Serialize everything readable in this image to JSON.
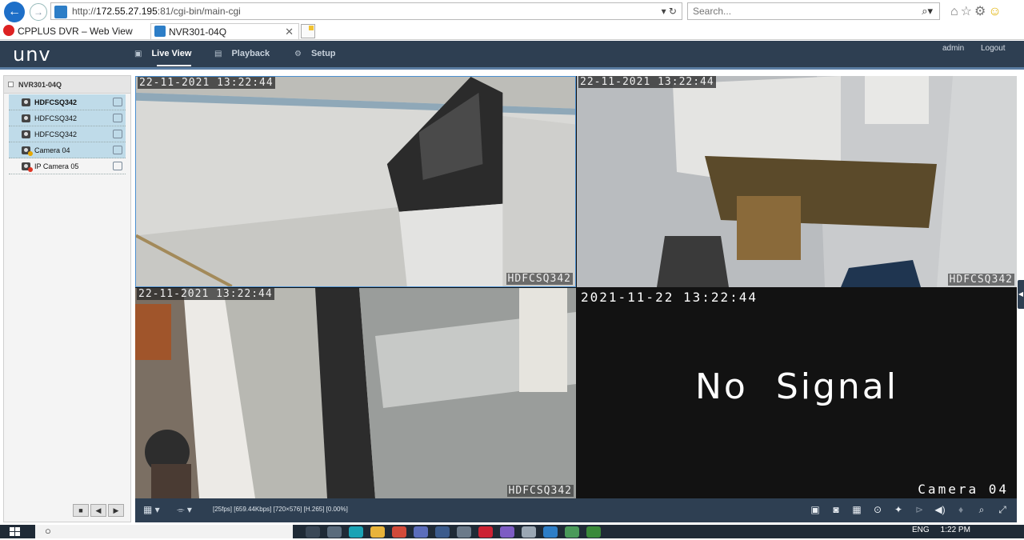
{
  "browser": {
    "address_prefix": "http://",
    "address_host": "172.55.27.195",
    "address_rest": ":81/cgi-bin/main-cgi",
    "address_controls": "▾ ↻",
    "search_placeholder": "Search...",
    "tabs": [
      {
        "label": "CPPLUS DVR – Web View"
      },
      {
        "label": "NVR301-04Q"
      }
    ]
  },
  "app": {
    "logo": "unv",
    "nav": [
      {
        "label": "Live View",
        "icon": "monitor-icon"
      },
      {
        "label": "Playback",
        "icon": "film-icon"
      },
      {
        "label": "Setup",
        "icon": "gear-icon"
      }
    ],
    "user": "admin",
    "logout": "Logout"
  },
  "sidebar": {
    "root": "NVR301-04Q",
    "cameras": [
      {
        "name": "HDFCSQ342",
        "status": "online"
      },
      {
        "name": "HDFCSQ342",
        "status": "online"
      },
      {
        "name": "HDFCSQ342",
        "status": "online"
      },
      {
        "name": "Camera 04",
        "status": "warning"
      },
      {
        "name": "IP Camera 05",
        "status": "offline"
      }
    ],
    "controls": [
      "■",
      "◀",
      "▶"
    ]
  },
  "tiles": [
    {
      "timestamp": "22-11-2021 13:22:44",
      "name": "HDFCSQ342"
    },
    {
      "timestamp": "22-11-2021 13:22:44",
      "name": "HDFCSQ342"
    },
    {
      "timestamp": "22-11-2021 13:22:44",
      "name": "HDFCSQ342"
    },
    {
      "timestamp": "2021-11-22 13:22:44",
      "name": "Camera 04",
      "message": "No Signal"
    }
  ],
  "toolbar": {
    "layout_label": "▦ ▾",
    "stream_label": "⌯ ▾",
    "stream_info": "[25fps] [659.44Kbps] [720×576] [H.265] [0.00%]"
  },
  "taskbar": {
    "language": "ENG",
    "time": "1:22 PM"
  }
}
